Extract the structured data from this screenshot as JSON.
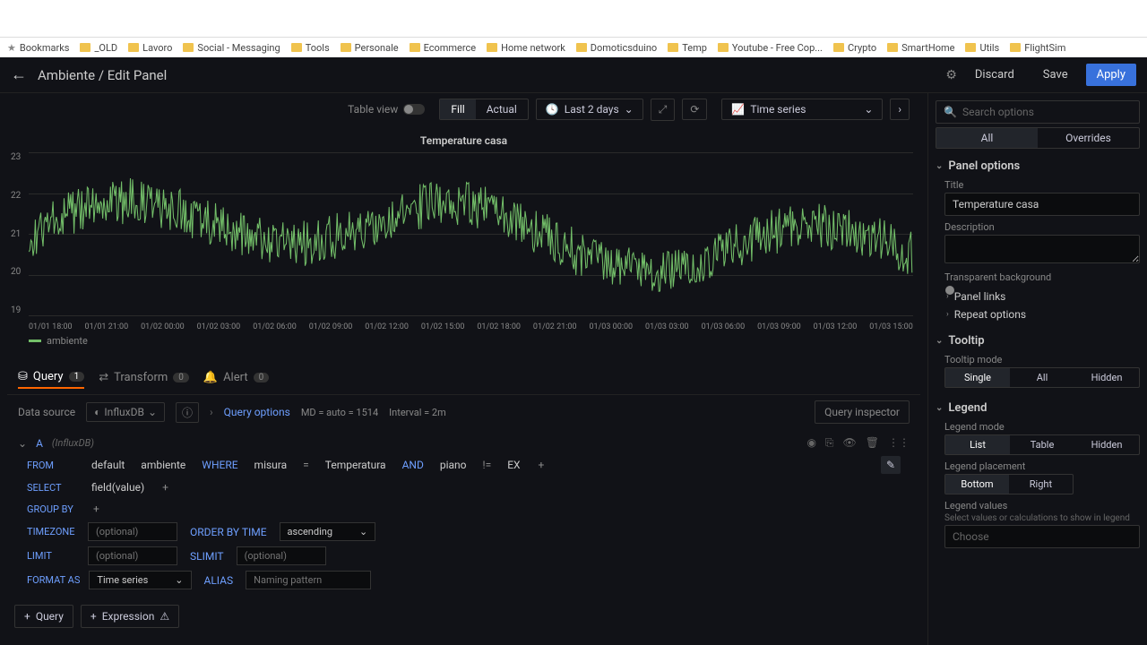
{
  "browser": {
    "bookmarks": [
      "Bookmarks",
      "_OLD",
      "Lavoro",
      "Social - Messaging",
      "Tools",
      "Personale",
      "Ecommerce",
      "Home network",
      "Domoticsduino",
      "Temp",
      "Youtube - Free Cop...",
      "Crypto",
      "SmartHome",
      "Utils",
      "FlightSim"
    ]
  },
  "header": {
    "breadcrumb": "Ambiente / Edit Panel",
    "discard": "Discard",
    "save": "Save",
    "apply": "Apply"
  },
  "toolbar": {
    "table_view": "Table view",
    "fill": "Fill",
    "actual": "Actual",
    "time_range": "Last 2 days",
    "viz_type": "Time series"
  },
  "chart_data": {
    "type": "line",
    "title": "Temperature casa",
    "y_ticks": [
      "23",
      "22",
      "21",
      "20",
      "19"
    ],
    "x_ticks": [
      "01/01 18:00",
      "01/01 21:00",
      "01/02 00:00",
      "01/02 03:00",
      "01/02 06:00",
      "01/02 09:00",
      "01/02 12:00",
      "01/02 15:00",
      "01/02 18:00",
      "01/02 21:00",
      "01/03 00:00",
      "01/03 03:00",
      "01/03 06:00",
      "01/03 09:00",
      "01/03 12:00",
      "01/03 15:00"
    ],
    "ylim": [
      19,
      23
    ],
    "legend": "ambiente",
    "series": [
      {
        "name": "ambiente",
        "color": "#73BF69",
        "approx_range": [
          19.2,
          22.8
        ],
        "description": "dense noisy temperature signal oscillating mostly between 19.5 and 22.5 over 48h"
      }
    ]
  },
  "tabs": {
    "query": "Query",
    "query_badge": "1",
    "transform": "Transform",
    "transform_badge": "0",
    "alert": "Alert",
    "alert_badge": "0"
  },
  "qbar": {
    "ds_label": "Data source",
    "ds_value": "InfluxDB",
    "options": "Query options",
    "md": "MD = auto = 1514",
    "interval": "Interval = 2m",
    "inspector": "Query inspector"
  },
  "query": {
    "letter": "A",
    "source": "(InfluxDB)",
    "from": {
      "key": "FROM",
      "default": "default",
      "measurement": "ambiente",
      "where": "WHERE",
      "tag": "misura",
      "eq": "=",
      "val": "Temperatura",
      "and": "AND",
      "tag2": "piano",
      "neq": "!=",
      "val2": "EX",
      "plus": "+"
    },
    "select": {
      "key": "SELECT",
      "field": "field(value)",
      "plus": "+"
    },
    "groupby": {
      "key": "GROUP BY",
      "plus": "+"
    },
    "tz": {
      "key": "TIMEZONE",
      "placeholder": "(optional)",
      "orderby": "ORDER BY TIME",
      "order_val": "ascending"
    },
    "limit": {
      "key": "LIMIT",
      "placeholder": "(optional)",
      "slimit": "SLIMIT",
      "slimit_ph": "(optional)"
    },
    "format": {
      "key": "FORMAT AS",
      "val": "Time series",
      "alias": "ALIAS",
      "alias_ph": "Naming pattern"
    }
  },
  "add": {
    "query": "Query",
    "expr": "Expression"
  },
  "side": {
    "search_ph": "Search options",
    "all": "All",
    "overrides": "Overrides",
    "panel_options": "Panel options",
    "title_label": "Title",
    "title_val": "Temperature casa",
    "desc_label": "Description",
    "transparent": "Transparent background",
    "panel_links": "Panel links",
    "repeat": "Repeat options",
    "tooltip": "Tooltip",
    "tooltip_mode": "Tooltip mode",
    "tt_single": "Single",
    "tt_all": "All",
    "tt_hidden": "Hidden",
    "legend": "Legend",
    "legend_mode": "Legend mode",
    "lm_list": "List",
    "lm_table": "Table",
    "lm_hidden": "Hidden",
    "legend_placement": "Legend placement",
    "lp_bottom": "Bottom",
    "lp_right": "Right",
    "legend_values": "Legend values",
    "legend_values_help": "Select values or calculations to show in legend",
    "choose": "Choose"
  }
}
